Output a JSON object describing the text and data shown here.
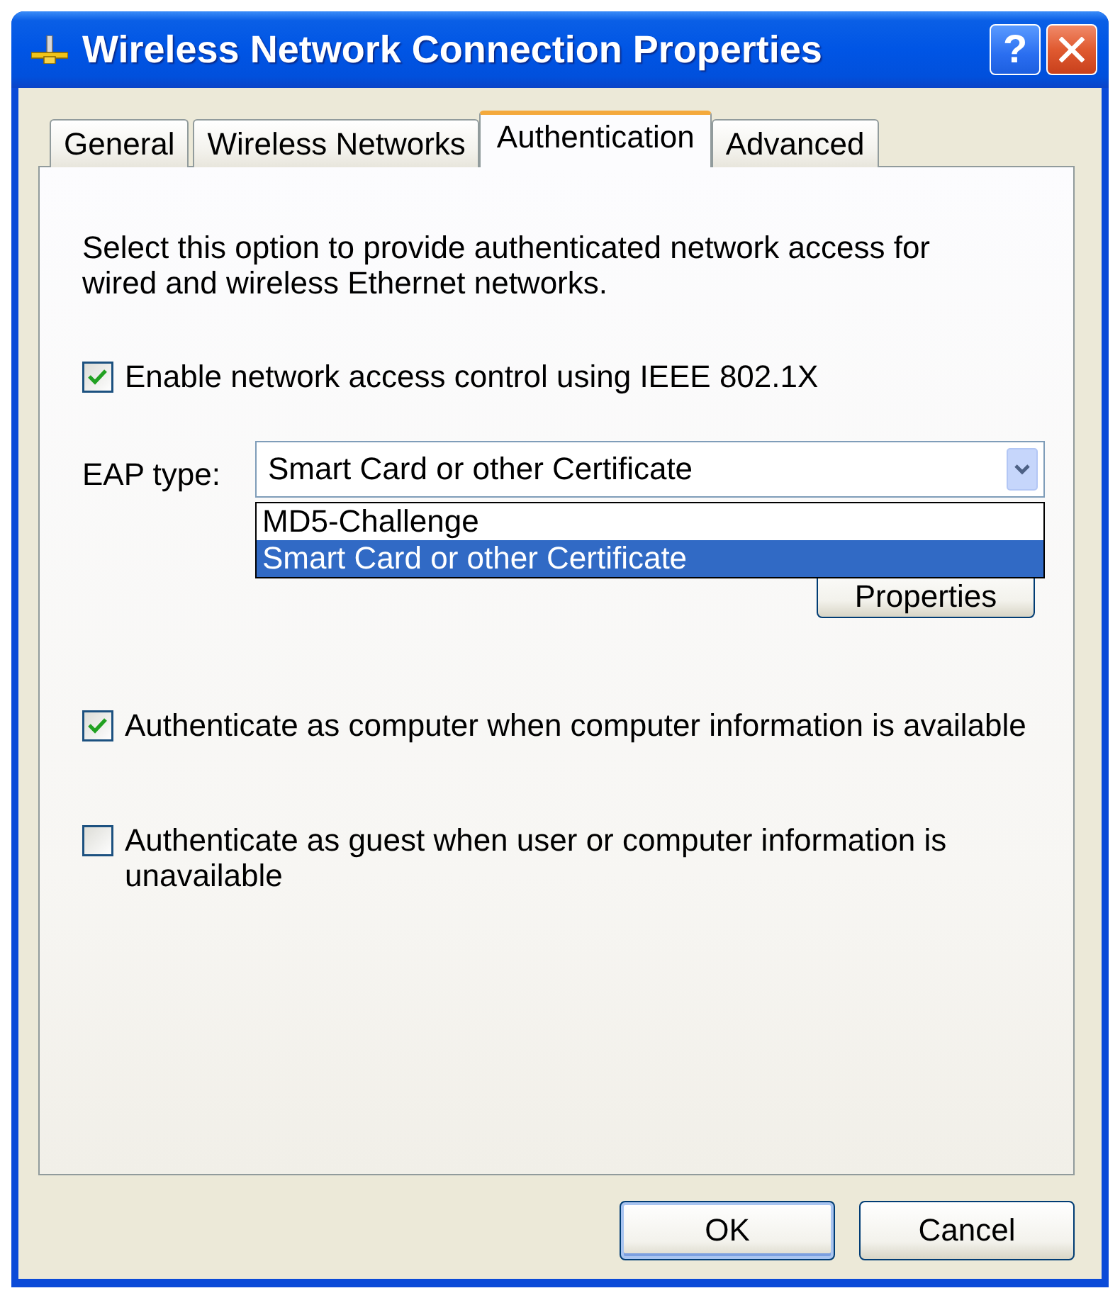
{
  "window": {
    "title": "Wireless Network Connection Properties",
    "help_button": "?"
  },
  "tabs": [
    {
      "label": "General",
      "selected": false
    },
    {
      "label": "Wireless Networks",
      "selected": false
    },
    {
      "label": "Authentication",
      "selected": true
    },
    {
      "label": "Advanced",
      "selected": false
    }
  ],
  "panel": {
    "description": "Select this option to provide authenticated network access for wired and wireless Ethernet networks.",
    "enable_checkbox": {
      "label": "Enable network access control using IEEE 802.1X",
      "checked": true
    },
    "eap_type": {
      "label": "EAP type:",
      "value": "Smart Card or other Certificate",
      "expanded": true,
      "options": [
        {
          "label": "MD5-Challenge",
          "selected": false
        },
        {
          "label": "Smart Card or other Certificate",
          "selected": true
        }
      ]
    },
    "properties_button": {
      "label": "Properties"
    },
    "auth_checkboxes": [
      {
        "label": "Authenticate as computer when computer information is available",
        "checked": true
      },
      {
        "label": "Authenticate as guest when user or computer information is unavailable",
        "checked": false
      }
    ]
  },
  "buttons": [
    {
      "label": "OK",
      "default": true
    },
    {
      "label": "Cancel",
      "default": false
    }
  ]
}
